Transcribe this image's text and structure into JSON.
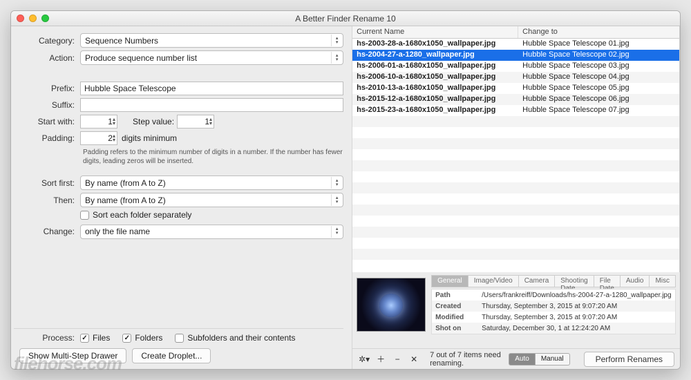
{
  "window": {
    "title": "A Better Finder Rename 10"
  },
  "labels": {
    "category": "Category:",
    "action": "Action:",
    "prefix": "Prefix:",
    "suffix": "Suffix:",
    "startwith": "Start with:",
    "stepvalue": "Step value:",
    "padding": "Padding:",
    "padding_suffix": "digits minimum",
    "sortfirst": "Sort first:",
    "then": "Then:",
    "change": "Change:",
    "process": "Process:"
  },
  "values": {
    "category": "Sequence Numbers",
    "action": "Produce sequence number list",
    "prefix": "Hubble Space Telescope",
    "suffix": "",
    "startwith": "1",
    "stepvalue": "1",
    "padding": "2",
    "sortfirst": "By name (from A to Z)",
    "then": "By name (from A to Z)",
    "sort_each": "Sort each folder separately",
    "change": "only the file name",
    "padding_hint": "Padding refers to the minimum number of digits in a number. If the number has fewer digits, leading zeros will be inserted."
  },
  "process": {
    "files": "Files",
    "folders": "Folders",
    "subfolders": "Subfolders and their contents"
  },
  "buttons": {
    "multistep": "Show Multi-Step Drawer",
    "droplet": "Create Droplet...",
    "perform": "Perform Renames",
    "auto": "Auto",
    "manual": "Manual"
  },
  "table": {
    "head_current": "Current Name",
    "head_change": "Change to",
    "rows": [
      {
        "cur": "hs-2003-28-a-1680x1050_wallpaper.jpg",
        "new": "Hubble Space Telescope 01.jpg"
      },
      {
        "cur": "hs-2004-27-a-1280_wallpaper.jpg",
        "new": "Hubble Space Telescope 02.jpg"
      },
      {
        "cur": "hs-2006-01-a-1680x1050_wallpaper.jpg",
        "new": "Hubble Space Telescope 03.jpg"
      },
      {
        "cur": "hs-2006-10-a-1680x1050_wallpaper.jpg",
        "new": "Hubble Space Telescope 04.jpg"
      },
      {
        "cur": "hs-2010-13-a-1680x1050_wallpaper.jpg",
        "new": "Hubble Space Telescope 05.jpg"
      },
      {
        "cur": "hs-2015-12-a-1680x1050_wallpaper.jpg",
        "new": "Hubble Space Telescope 06.jpg"
      },
      {
        "cur": "hs-2015-23-a-1680x1050_wallpaper.jpg",
        "new": "Hubble Space Telescope 07.jpg"
      }
    ]
  },
  "tabs": [
    "General",
    "Image/Video",
    "Camera",
    "Shooting Date",
    "File Date",
    "Audio",
    "Misc"
  ],
  "meta": {
    "path_k": "Path",
    "path_v": "/Users/frankreiff/Downloads/hs-2004-27-a-1280_wallpaper.jpg",
    "created_k": "Created",
    "created_v": "Thursday, September 3, 2015 at 9:07:20 AM",
    "modified_k": "Modified",
    "modified_v": "Thursday, September 3, 2015 at 9:07:20 AM",
    "shot_k": "Shot on",
    "shot_v": "Saturday, December 30, 1 at 12:24:20 AM"
  },
  "status": "7 out of 7 items need renaming.",
  "watermark": "filehorse.com"
}
